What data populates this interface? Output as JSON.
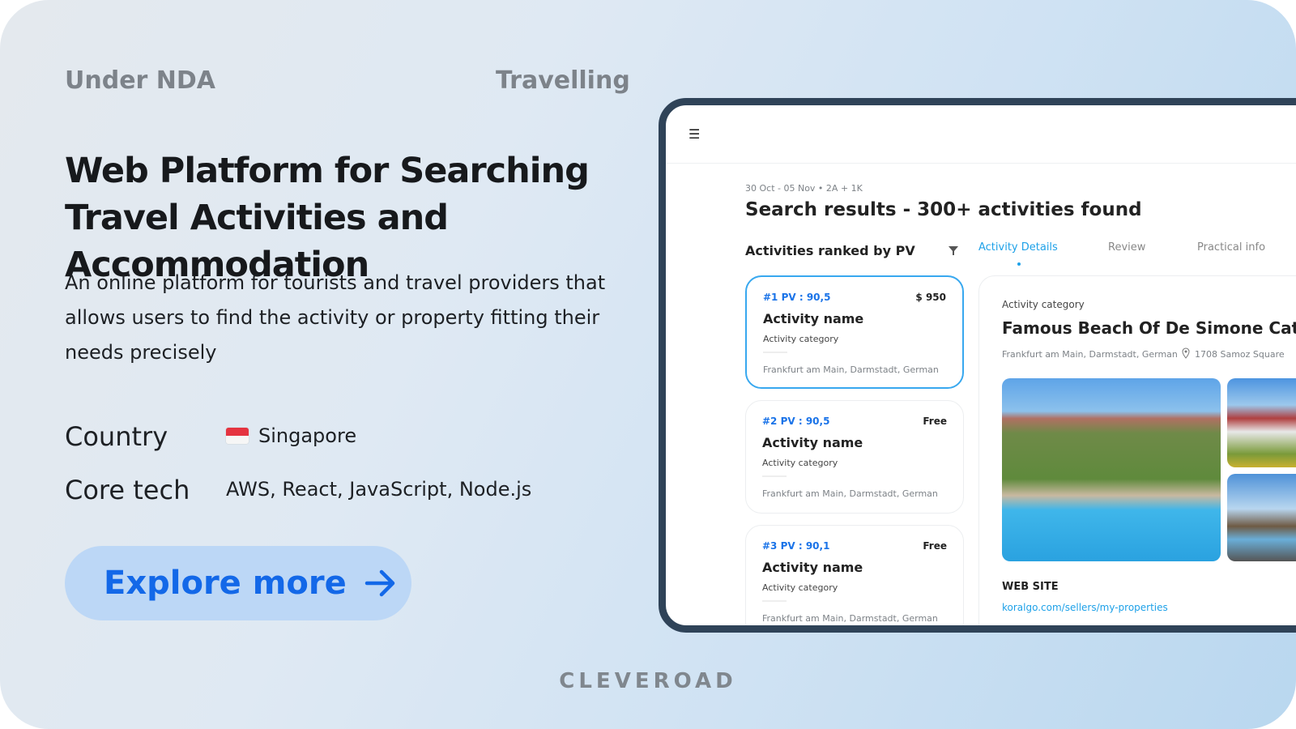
{
  "header": {
    "left_tag": "Under NDA",
    "right_tag": "Travelling"
  },
  "title": "Web Platform for Searching Travel Activities and Accommodation",
  "description": "An online platform for tourists and travel providers that allows users to find the activity or property fitting their needs precisely",
  "meta": {
    "country_label": "Country",
    "country_value": "Singapore",
    "country_flag": "singapore-flag",
    "tech_label": "Core tech",
    "tech_value": "AWS, React, JavaScript, Node.js"
  },
  "cta": {
    "label": "Explore more",
    "icon": "arrow-right-icon"
  },
  "brand": "CLEVEROAD",
  "colors": {
    "accent": "#1368e8",
    "frame": "#2f4358",
    "selected_border": "#38a8ef"
  },
  "app": {
    "menu_icon": "hamburger-icon",
    "trip_info": "30 Oct - 05 Nov  •  2A + 1K",
    "results_title": "Search results - 300+ activities found",
    "ranked_label": "Activities ranked by PV",
    "tabs": [
      {
        "label": "Activity Details",
        "active": true
      },
      {
        "label": "Review"
      },
      {
        "label": "Practical info"
      }
    ],
    "activities": [
      {
        "rank": "#1 PV : 90,5",
        "price": "$ 950",
        "name": "Activity name",
        "category": "Activity category",
        "location": "Frankfurt am Main, Darmstadt, German"
      },
      {
        "rank": "#2 PV : 90,5",
        "price": "Free",
        "name": "Activity name",
        "category": "Activity category",
        "location": "Frankfurt am Main, Darmstadt, German"
      },
      {
        "rank": "#3 PV : 90,1",
        "price": "Free",
        "name": "Activity name",
        "category": "Activity category",
        "location": "Frankfurt am Main, Darmstadt, German"
      }
    ],
    "details": {
      "category": "Activity category",
      "name": "Famous Beach Of De Simone Cate",
      "location": "Frankfurt am Main, Darmstadt, German",
      "address": "1708 Samoz Square",
      "website_label": "WEB SITE",
      "website": "koralgo.com/sellers/my-properties"
    }
  }
}
